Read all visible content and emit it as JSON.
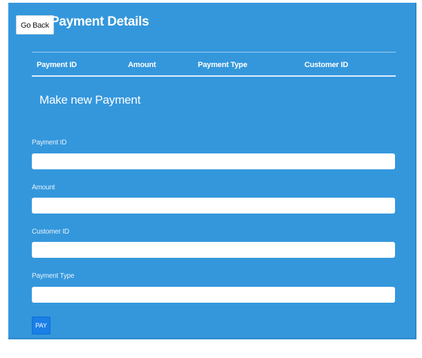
{
  "header": {
    "back_label": "Go Back",
    "title": "Payment Details"
  },
  "table": {
    "columns": [
      "Payment ID",
      "Amount",
      "Payment Type",
      "Customer ID"
    ],
    "rows": []
  },
  "form": {
    "title": "Make new Payment",
    "fields": [
      {
        "label": "Payment ID",
        "value": "",
        "placeholder": ""
      },
      {
        "label": "Amount",
        "value": "",
        "placeholder": ""
      },
      {
        "label": "Customer ID",
        "value": "",
        "placeholder": ""
      },
      {
        "label": "Payment Type",
        "value": "",
        "placeholder": ""
      }
    ],
    "submit_label": "PAY"
  },
  "colors": {
    "panel_background": "#3497dc",
    "button_primary": "#1a7fe6",
    "text_light": "#ffffff"
  }
}
